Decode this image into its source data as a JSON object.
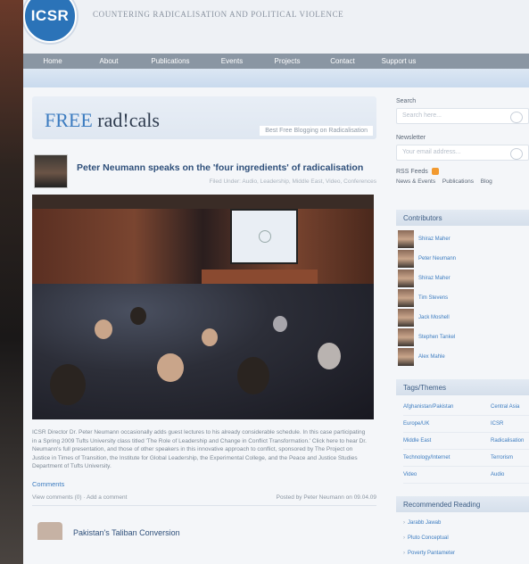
{
  "header": {
    "logo_text": "ICSR",
    "tagline": "COUNTERING RADICALISATION AND POLITICAL VIOLENCE"
  },
  "nav": [
    "Home",
    "About",
    "Publications",
    "Events",
    "Projects",
    "Contact",
    "Support us"
  ],
  "blog": {
    "title_free": "FREE",
    "title_radicals": "rad!cals",
    "subtitle": "Best Free Blogging on Radicalisation"
  },
  "post": {
    "title": "Peter Neumann speaks on the 'four ingredients' of radicalisation",
    "meta": "Filed Under: Audio, Leadership, Middle East, Video, Conferences",
    "slide_logo": "ICSR",
    "caption": "ICSR Director Dr. Peter Neumann occasionally adds guest lectures to his already considerable schedule. In this case participating in a Spring 2009 Tufts University class titled 'The Role of Leadership and Change in Conflict Transformation.' Click here to hear Dr. Neumann's full presentation, and those of other speakers in this innovative approach to conflict, sponsored by The Project on Justice in Times of Transition, the Institute for Global Leadership, the Experimental College, and the Peace and Justice Studies Department of Tufts University.",
    "comments_heading": "Comments",
    "view_comments": "View comments (0)",
    "add_comment": "Add a comment",
    "posted_by": "Posted by Peter Neumann on 09.04.09"
  },
  "next_post": {
    "title": "Pakistan's Taliban Conversion"
  },
  "sidebar": {
    "search_label": "Search",
    "search_placeholder": "Search here...",
    "newsletter_label": "Newsletter",
    "newsletter_placeholder": "Your email address...",
    "rss_label": "RSS Feeds",
    "rss_links": [
      "News & Events",
      "Publications",
      "Blog"
    ],
    "contributors_heading": "Contributors",
    "contributors": [
      "Shiraz Maher",
      "Peter Neumann",
      "Shiraz Maher",
      "Tim Stevens",
      "Jack Moshell",
      "Stephen Tankel",
      "Alex Mahle"
    ],
    "tags_heading": "Tags/Themes",
    "tags": [
      "Afghanistan/Pakistan",
      "Central Asia",
      "Europe/UK",
      "ICSR",
      "Middle East",
      "Radicalisation",
      "Technology/Internet",
      "Terrorism",
      "Video",
      "Audio"
    ],
    "reading_heading": "Recommended Reading",
    "reading": [
      "Jarabb Jawab",
      "Pluto Conceptual",
      "Poverty Pantameter"
    ]
  },
  "colors": {
    "accent": "#3c7cc0",
    "nav_bg": "#8a96a3",
    "feed": "#f29a30"
  }
}
